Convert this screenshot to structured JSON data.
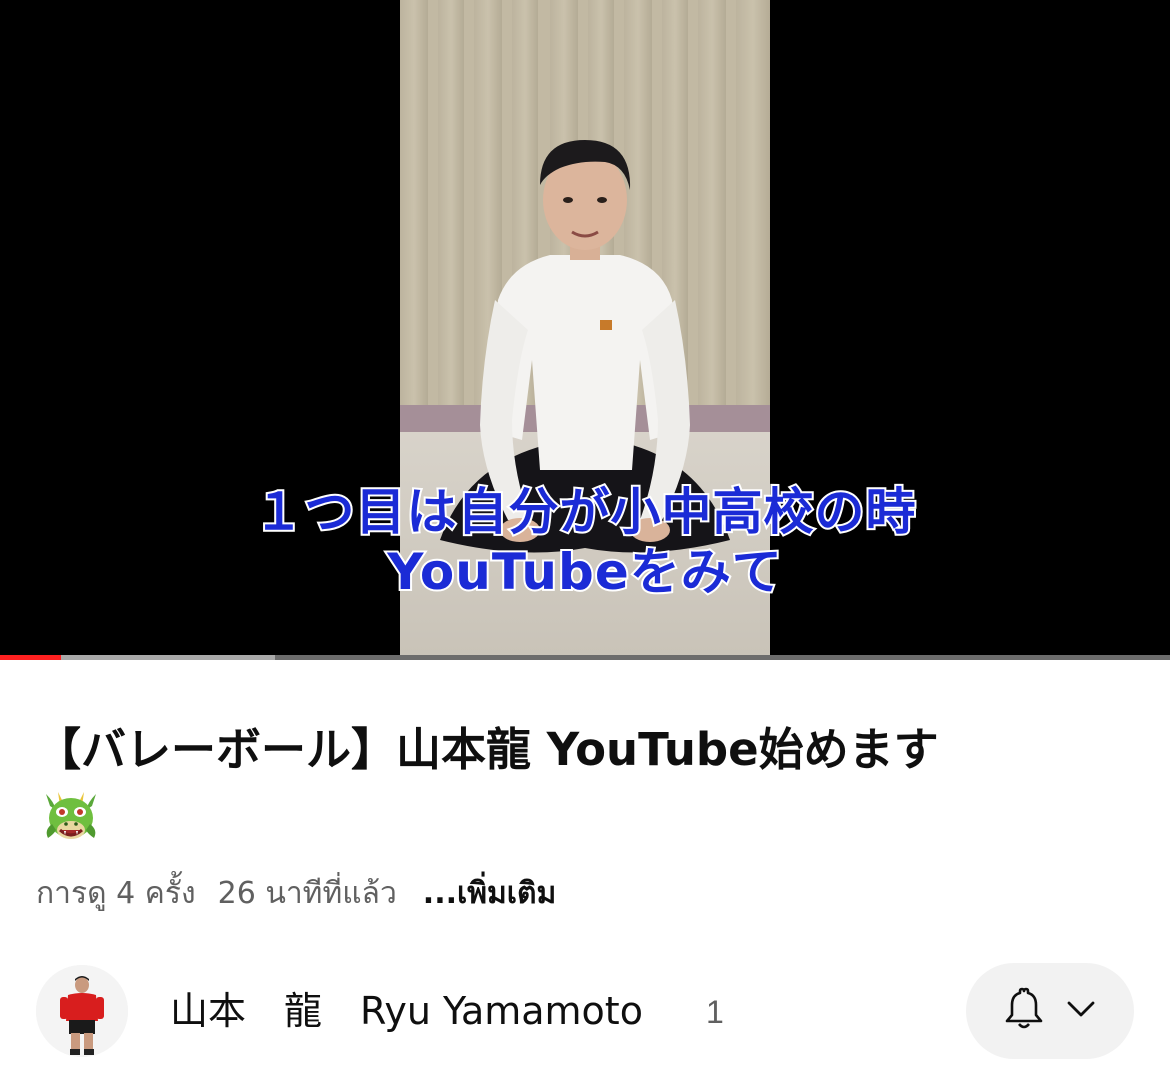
{
  "video": {
    "caption_line1": "１つ目は自分が小中高校の時",
    "caption_line2": "YouTubeをみて",
    "progress_played": 0.052,
    "progress_buffered": 0.235
  },
  "meta": {
    "title": "【バレーボール】山本龍 YouTube始めます",
    "title_emoji_icon": "dragon-face-icon",
    "views": "การดู 4 ครั้ง",
    "time_ago": "26 นาทีที่แล้ว",
    "more_label": "...เพิ่มเติม"
  },
  "channel": {
    "name": "山本　龍　Ryu Yamamoto",
    "subscribers": "1",
    "avatar_icon": "channel-avatar",
    "bell_icon": "bell-icon",
    "chevron_icon": "chevron-down-icon"
  },
  "colors": {
    "progress_played": "#ff2020",
    "caption_fill": "#1b2bd6",
    "caption_stroke": "#ffffff"
  }
}
